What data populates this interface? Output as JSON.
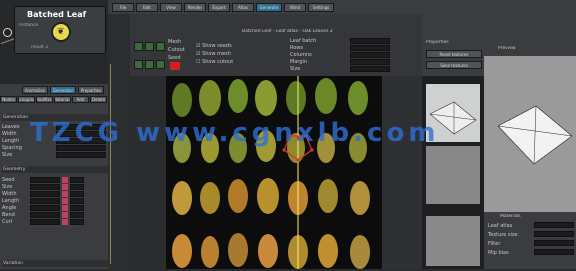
{
  "node_title": "Batched Leaf",
  "node_sub": "Instance",
  "node_count": "result 3",
  "graph_tabs": [
    "Animation",
    "Generator",
    "Properties"
  ],
  "left_tabs": [
    "Nodes",
    "Grouping",
    "Modifiers",
    "Materials",
    "Add",
    "Delete"
  ],
  "left_section": "Generation",
  "left_rows": [
    "Leaves",
    "Width",
    "Length",
    "Spacing",
    "Size"
  ],
  "left_section2": "Geometry",
  "left_rows2": [
    "Seed",
    "Size",
    "Width",
    "Length",
    "Angle",
    "Bend",
    "Curl"
  ],
  "left_footer": "Variation",
  "center_title": "Batched Leaf - Leaf atlas - Oak Leaves 2",
  "center_options": [
    "Show seeds",
    "Show mesh",
    "Show cutout"
  ],
  "center_labels": [
    "Mesh",
    "Cutout",
    "Seed"
  ],
  "center_fields": [
    "Leaf batch",
    "Rows",
    "Columns",
    "Margin",
    "Size"
  ],
  "right_props_title": "Properties",
  "right_props_buttons": [
    "Reset textures",
    "Save textures"
  ],
  "right_preview_title": "Preview",
  "right_lower_title": "Materials",
  "right_lower_rows": [
    "Leaf atlas",
    "Texture size",
    "Filter",
    "Mip bias"
  ],
  "toolbar_buttons": [
    "File",
    "Edit",
    "View",
    "Render",
    "Export",
    "Atlas",
    "Generate",
    "Wind",
    "Settings"
  ],
  "watermark": "TZCG www.cgnxlb.com",
  "colors": {
    "accent": "#2f6f8f",
    "leaf_green": "#6f8a2a",
    "leaf_orange": "#c08a30",
    "leaf_yellow": "#b0a040"
  }
}
